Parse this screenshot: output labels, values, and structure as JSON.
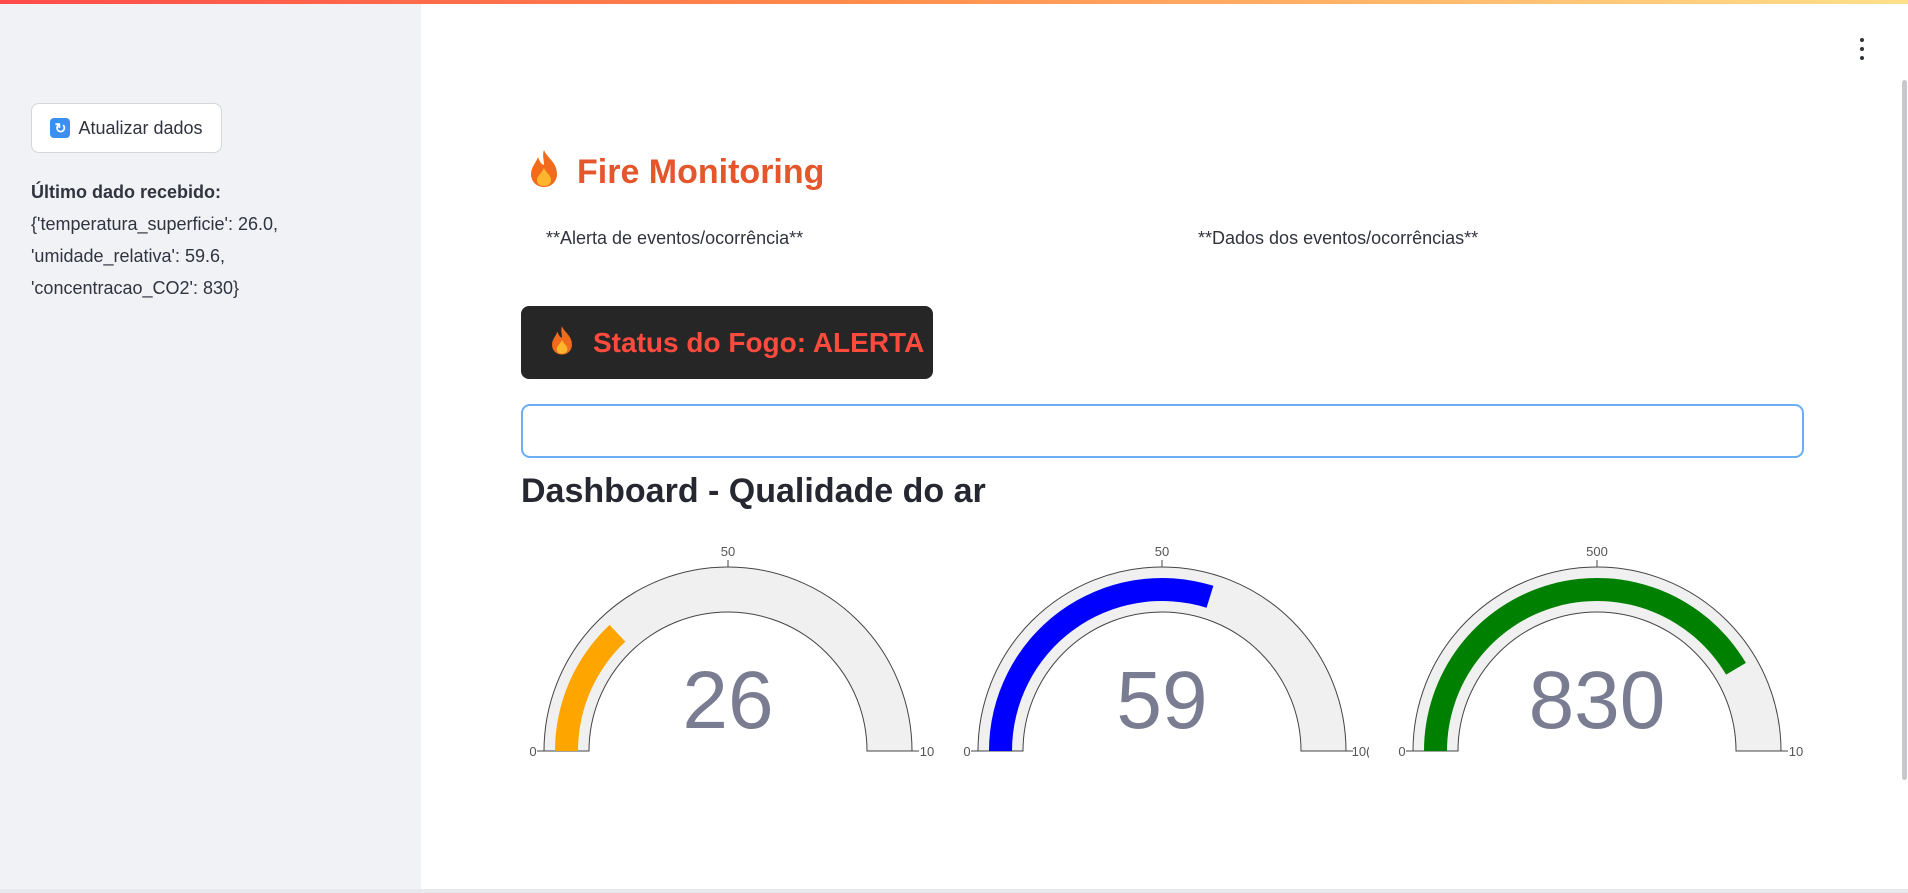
{
  "sidebar": {
    "refresh_button_label": "Atualizar dados",
    "refresh_icon": "arrows-refresh-icon",
    "last_data_title": "Último dado recebido:",
    "last_data_lines": [
      "{'temperatura_superficie': 26.0,",
      "'umidade_relativa': 59.6,",
      "'concentracao_CO2': 830}"
    ]
  },
  "header": {
    "menu_icon": "kebab-menu-icon"
  },
  "main": {
    "title_icon": "fire-icon",
    "title": "Fire Monitoring",
    "col1_label": "**Alerta de eventos/ocorrência**",
    "col2_label": "**Dados dos eventos/ocorrências**",
    "status": {
      "icon": "fire-icon",
      "text": "Status do Fogo: ALERTA",
      "text_color": "#ff4b3e",
      "background": "#262626"
    },
    "input": {
      "value": "",
      "placeholder": ""
    },
    "dashboard_title": "Dashboard - Qualidade do ar"
  },
  "gauges": [
    {
      "value": 26,
      "value_label": "26",
      "min": 0,
      "max": 100,
      "min_label": "0",
      "mid_label": "50",
      "max_label": "10",
      "color": "#ffa500"
    },
    {
      "value": 59.6,
      "value_label": "59",
      "min": 0,
      "max": 100,
      "min_label": "0",
      "mid_label": "50",
      "max_label": "10(",
      "color": "#0000ff"
    },
    {
      "value": 830,
      "value_label": "830",
      "min": 0,
      "max": 1000,
      "min_label": "0",
      "mid_label": "500",
      "max_label": "10",
      "color": "#008000"
    }
  ]
}
